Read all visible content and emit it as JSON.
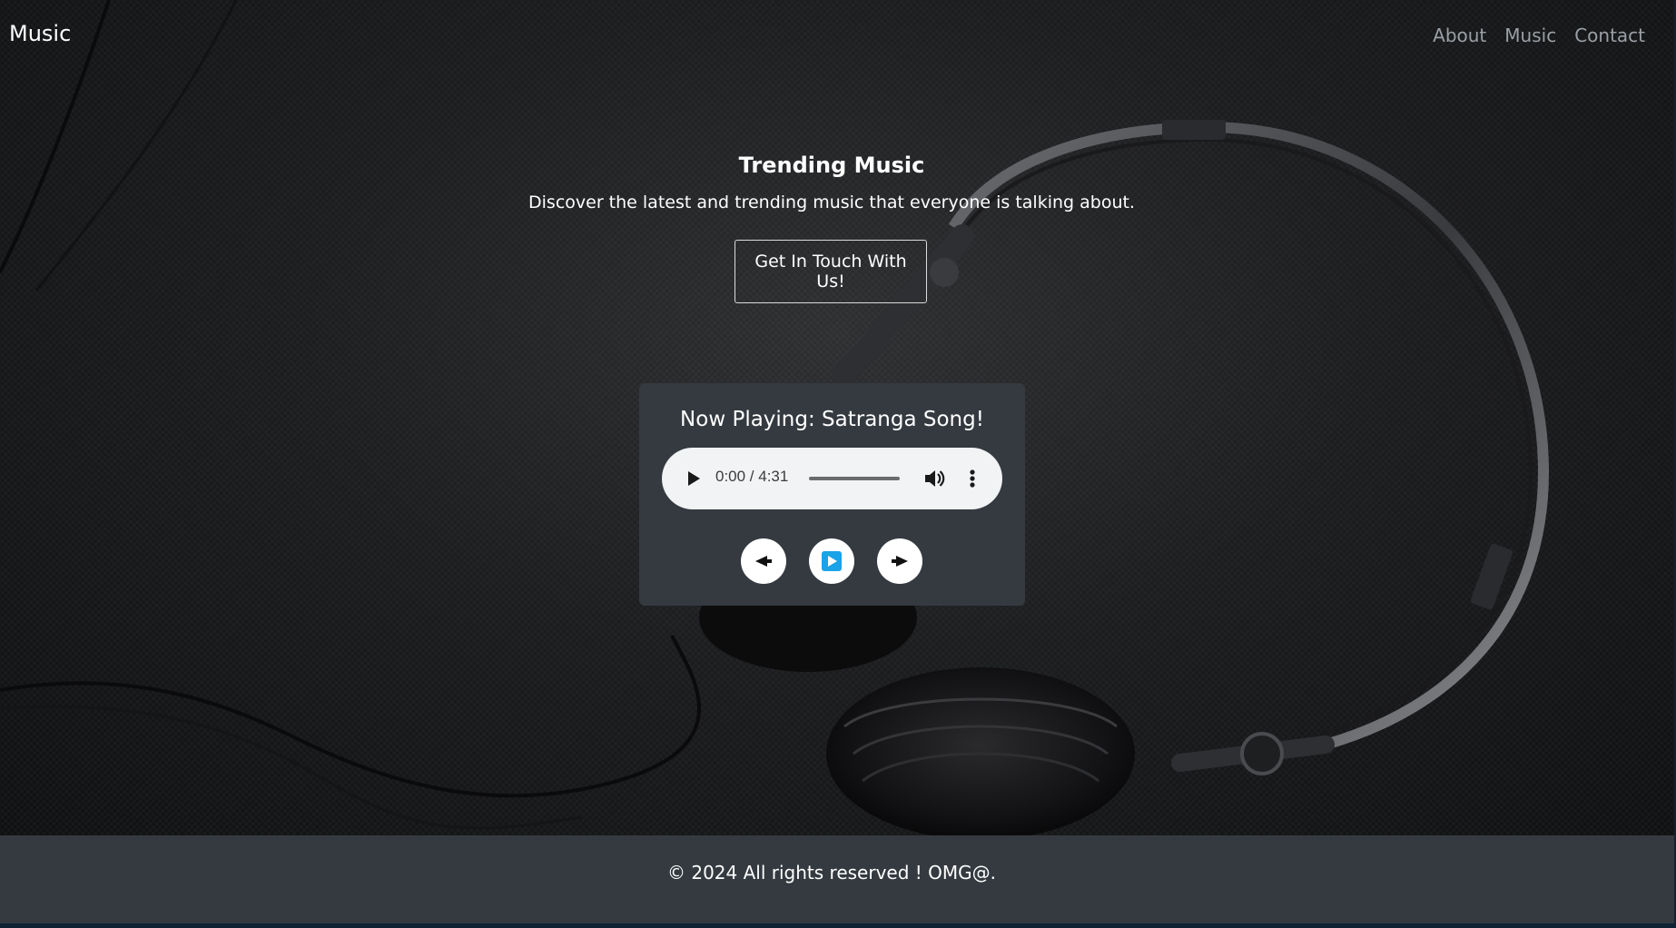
{
  "navbar": {
    "brand": "Music",
    "links": [
      "About",
      "Music",
      "Contact"
    ]
  },
  "hero": {
    "title": "Trending Music",
    "subtitle": "Discover the latest and trending music that everyone is talking about.",
    "cta_label": "Get In Touch With Us!"
  },
  "player": {
    "title": "Now Playing: Satranga Song!",
    "time": "0:00 / 4:31",
    "progress": 0,
    "controls": {
      "prev_icon": "arrow-left-icon",
      "play_icon": "play-icon",
      "next_icon": "arrow-right-icon"
    },
    "accent_color": "#1aa3e8"
  },
  "footer": {
    "text": "© 2024 All rights reserved ! OMG@."
  }
}
